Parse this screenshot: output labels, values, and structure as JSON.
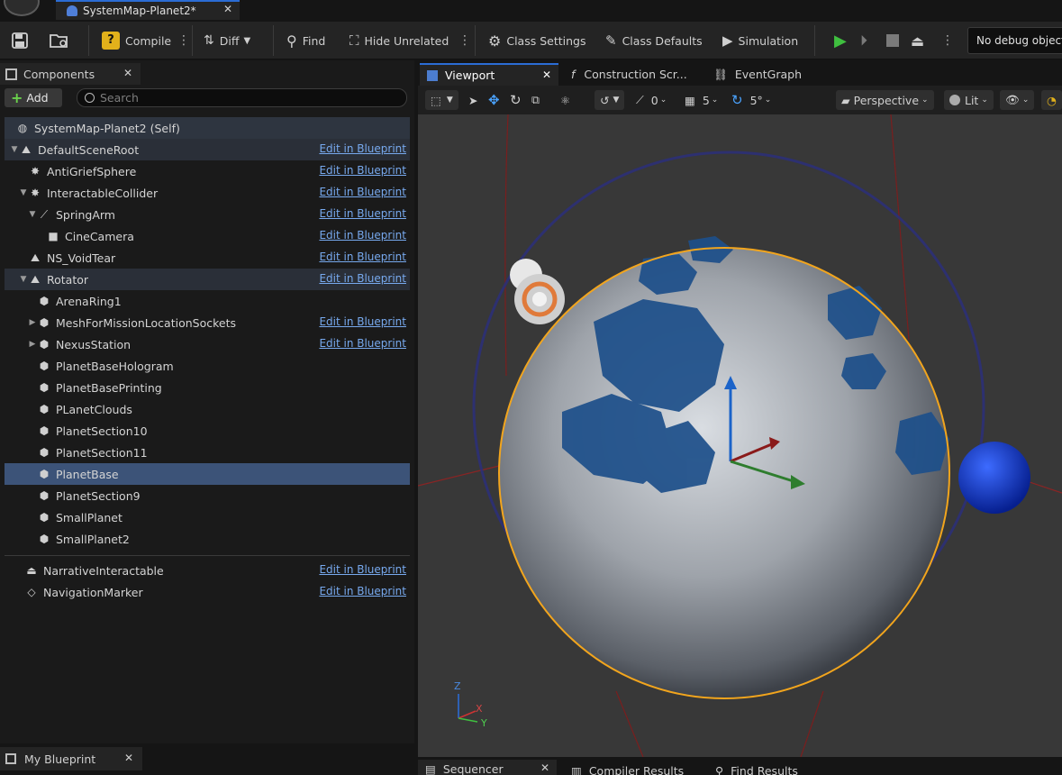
{
  "asset_tab": {
    "title": "SystemMap-Planet2*"
  },
  "toolbar": {
    "compile": "Compile",
    "diff": "Diff",
    "find": "Find",
    "hide_unrelated": "Hide Unrelated",
    "class_settings": "Class Settings",
    "class_defaults": "Class Defaults",
    "simulation": "Simulation",
    "debug_object": "No debug object"
  },
  "components": {
    "tab_label": "Components",
    "add_label": "Add",
    "search_placeholder": "Search",
    "edit_link": "Edit in Blueprint",
    "items": [
      {
        "label": "SystemMap-Planet2 (Self)",
        "icon": "actor-icon",
        "depth": 0,
        "expander": "",
        "edit": false,
        "style": "self"
      },
      {
        "label": "DefaultSceneRoot",
        "icon": "scene-root-icon",
        "depth": 1,
        "expander": "open",
        "edit": true,
        "style": "hdr"
      },
      {
        "label": "AntiGriefSphere",
        "icon": "sphere-collision-icon",
        "depth": 2,
        "expander": "",
        "edit": true,
        "style": ""
      },
      {
        "label": "InteractableCollider",
        "icon": "collider-icon",
        "depth": 2,
        "expander": "open",
        "edit": true,
        "style": ""
      },
      {
        "label": "SpringArm",
        "icon": "spring-arm-icon",
        "depth": 3,
        "expander": "open",
        "edit": true,
        "style": ""
      },
      {
        "label": "CineCamera",
        "icon": "camera-icon",
        "depth": 4,
        "expander": "",
        "edit": true,
        "style": ""
      },
      {
        "label": "NS_VoidTear",
        "icon": "niagara-icon",
        "depth": 2,
        "expander": "",
        "edit": true,
        "style": ""
      },
      {
        "label": "Rotator",
        "icon": "rotator-icon",
        "depth": 2,
        "expander": "open",
        "edit": true,
        "style": "hdr"
      },
      {
        "label": "ArenaRing1",
        "icon": "static-mesh-icon",
        "depth": 3,
        "expander": "",
        "edit": false,
        "style": ""
      },
      {
        "label": "MeshForMissionLocationSockets",
        "icon": "static-mesh-icon",
        "depth": 3,
        "expander": "closed",
        "edit": true,
        "style": ""
      },
      {
        "label": "NexusStation",
        "icon": "static-mesh-icon",
        "depth": 3,
        "expander": "closed",
        "edit": true,
        "style": ""
      },
      {
        "label": "PlanetBaseHologram",
        "icon": "static-mesh-icon",
        "depth": 3,
        "expander": "",
        "edit": false,
        "style": ""
      },
      {
        "label": "PlanetBasePrinting",
        "icon": "static-mesh-icon",
        "depth": 3,
        "expander": "",
        "edit": false,
        "style": ""
      },
      {
        "label": "PLanetClouds",
        "icon": "static-mesh-icon",
        "depth": 3,
        "expander": "",
        "edit": false,
        "style": ""
      },
      {
        "label": "PlanetSection10",
        "icon": "static-mesh-icon",
        "depth": 3,
        "expander": "",
        "edit": false,
        "style": ""
      },
      {
        "label": "PlanetSection11",
        "icon": "static-mesh-icon",
        "depth": 3,
        "expander": "",
        "edit": false,
        "style": ""
      },
      {
        "label": "PlanetBase",
        "icon": "static-mesh-icon",
        "depth": 3,
        "expander": "",
        "edit": false,
        "style": "selected"
      },
      {
        "label": "PlanetSection9",
        "icon": "static-mesh-icon",
        "depth": 3,
        "expander": "",
        "edit": false,
        "style": ""
      },
      {
        "label": "SmallPlanet",
        "icon": "static-mesh-icon",
        "depth": 3,
        "expander": "",
        "edit": false,
        "style": ""
      },
      {
        "label": "SmallPlanet2",
        "icon": "static-mesh-icon",
        "depth": 3,
        "expander": "",
        "edit": false,
        "style": ""
      }
    ],
    "extra_items": [
      {
        "label": "NarrativeInteractable",
        "icon": "narrative-icon",
        "edit": true
      },
      {
        "label": "NavigationMarker",
        "icon": "navigation-marker-icon",
        "edit": true
      }
    ]
  },
  "my_blueprint": {
    "tab_label": "My Blueprint"
  },
  "viewport_tabs": {
    "viewport": "Viewport",
    "construction": "Construction Scr...",
    "event_graph": "EventGraph"
  },
  "viewport_toolbar": {
    "rotation_snap": "0",
    "grid_snap": "5",
    "angle_snap": "5°",
    "view_mode": "Perspective",
    "lighting": "Lit"
  },
  "axes": {
    "z": "Z",
    "x": "X",
    "y": "Y"
  },
  "bottom_tabs": {
    "sequencer": "Sequencer",
    "compiler_results": "Compiler Results",
    "find_results": "Find Results"
  },
  "colors": {
    "selection": "#3c5378",
    "accent_tab": "#2b6cd4",
    "link": "#77a9ee",
    "play": "#3fbf3f",
    "planet_outline": "#f2a51d"
  }
}
